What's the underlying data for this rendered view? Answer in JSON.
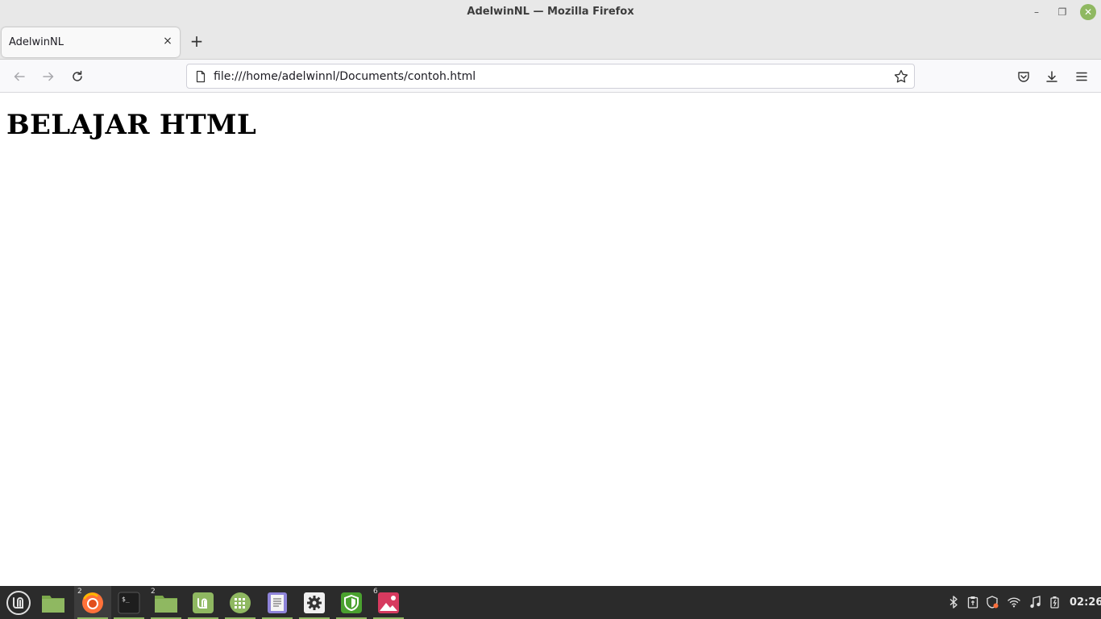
{
  "window": {
    "title": "AdelwinNL — Mozilla Firefox",
    "minimize_glyph": "–",
    "maximize_glyph": "❐",
    "close_glyph": "✕"
  },
  "tabs": [
    {
      "label": "AdelwinNL",
      "close_glyph": "×"
    }
  ],
  "new_tab_glyph": "+",
  "navbar": {
    "url": "file:///home/adelwinnl/Documents/contoh.html"
  },
  "page": {
    "heading": "BELAJAR HTML"
  },
  "taskbar": {
    "apps": [
      {
        "name": "mint-menu",
        "badge": ""
      },
      {
        "name": "files",
        "badge": ""
      },
      {
        "name": "firefox",
        "badge": "2"
      },
      {
        "name": "terminal",
        "badge": ""
      },
      {
        "name": "files",
        "badge": "2"
      },
      {
        "name": "mintinstall",
        "badge": ""
      },
      {
        "name": "spreadsheet",
        "badge": ""
      },
      {
        "name": "text-editor",
        "badge": ""
      },
      {
        "name": "settings",
        "badge": ""
      },
      {
        "name": "security",
        "badge": ""
      },
      {
        "name": "image-viewer",
        "badge": "6"
      }
    ],
    "clock": "02:26"
  },
  "colors": {
    "accent": "#8fb861",
    "taskbar": "#2b2b2b",
    "chrome": "#e8e8e8"
  }
}
